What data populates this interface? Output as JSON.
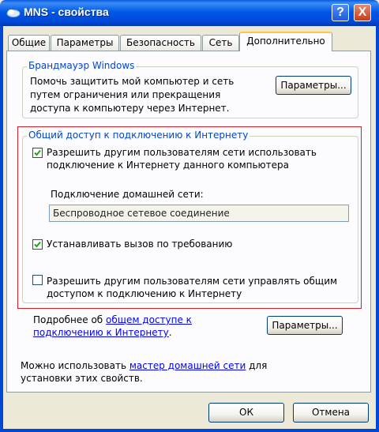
{
  "window": {
    "title": "MNS - свойства",
    "help_label": "?",
    "close_label": "X"
  },
  "tabs": [
    {
      "label": "Общие"
    },
    {
      "label": "Параметры"
    },
    {
      "label": "Безопасность"
    },
    {
      "label": "Сеть"
    },
    {
      "label": "Дополнительно"
    }
  ],
  "firewall": {
    "legend": "Брандмауэр Windows",
    "description_line1": "Помочь защитить мой компьютер и сеть",
    "description_line2": "путем ограничения или прекращения",
    "description_line3": "доступа к компьютеру через Интернет.",
    "settings_button": "Параметры..."
  },
  "ics": {
    "legend": "Общий доступ к подключению к Интернету",
    "allow_share_line1": "Разрешить другим пользователям сети использовать",
    "allow_share_line2": "подключение к Интернету данного компьютера",
    "allow_share_checked": true,
    "home_network_label": "Подключение домашней сети:",
    "home_network_value": "Беспроводное сетевое соединение",
    "dial_on_demand_label": "Устанавливать вызов по требованию",
    "dial_on_demand_checked": true,
    "allow_control_line1": "Разрешить другим пользователям сети управлять общим",
    "allow_control_line2": "доступом к подключению к Интернету",
    "allow_control_checked": false
  },
  "more_info": {
    "prefix": "Подробнее об ",
    "link_part1": "общем доступе к",
    "link_part2": "подключению к Интернету",
    "suffix": ".",
    "settings_button": "Параметры..."
  },
  "wizard": {
    "prefix": "Можно использовать ",
    "link": "мастер домашней сети",
    "suffix": " для",
    "line2": "установки этих свойств."
  },
  "footer": {
    "ok_label": "ОК",
    "cancel_label": "Отмена"
  }
}
